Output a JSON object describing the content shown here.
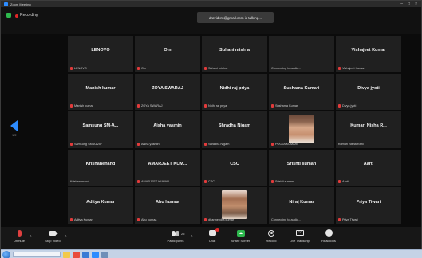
{
  "window": {
    "title": "Zoom Meeting"
  },
  "topbar": {
    "recording_label": "Recording",
    "talking_text": "dravidkru@gmail.com is talking..."
  },
  "participants": [
    {
      "name": "LENOVO",
      "label": "LENOVO",
      "muted": true
    },
    {
      "name": "Om",
      "label": "Om",
      "muted": true
    },
    {
      "name": "Suhani mishra",
      "label": "Suhani mishra",
      "muted": true
    },
    {
      "name": "",
      "label": "Connecting to audio...",
      "muted": false
    },
    {
      "name": "Vishajeet Kumar",
      "label": "Vishajeet Kumar",
      "muted": true
    },
    {
      "name": "Manish kumar",
      "label": "Manish kumar",
      "muted": true
    },
    {
      "name": "ZOYA SWARAJ",
      "label": "ZOYA SWARAJ",
      "muted": true
    },
    {
      "name": "Nidhi raj priya",
      "label": "Nidhi raj priya",
      "muted": true
    },
    {
      "name": "Sushama Kumari",
      "label": "Sushama Kumari",
      "muted": true
    },
    {
      "name": "Divya jyoti",
      "label": "Divya jyoti",
      "muted": true
    },
    {
      "name": "Samsung SM-A...",
      "label": "Samsung SM-A125F",
      "muted": true
    },
    {
      "name": "Aisha yasmin",
      "label": "Aisha yasmin",
      "muted": true
    },
    {
      "name": "Shradha Nigam",
      "label": "Shradha Nigam",
      "muted": true
    },
    {
      "name": "",
      "label": "POOJA KUMARI",
      "muted": true,
      "photo": "female"
    },
    {
      "name": "Kumari Nisha R...",
      "label": "Kumari Nisha Rani",
      "muted": false
    },
    {
      "name": "Krishanenand",
      "label": "Krishanenand",
      "muted": false
    },
    {
      "name": "AMARJEET KUM...",
      "label": "AMARJEET KUMAR",
      "muted": true
    },
    {
      "name": "CSC",
      "label": "CSC",
      "muted": true
    },
    {
      "name": "Srishti suman",
      "label": "Srishti suman",
      "muted": true
    },
    {
      "name": "Aarti",
      "label": "Aarti",
      "muted": true
    },
    {
      "name": "Aditya Kumar",
      "label": "Aditya Kumar",
      "muted": true
    },
    {
      "name": "Abu humaa",
      "label": "Abu humaa",
      "muted": true
    },
    {
      "name": "",
      "label": "dharmendra kumar",
      "muted": true,
      "photo": "male"
    },
    {
      "name": "Niraj Kumar",
      "label": "Connecting to audio...",
      "muted": false
    },
    {
      "name": "Priya Tiwari",
      "label": "Priya Tiwari",
      "muted": true
    }
  ],
  "sidebar": {
    "page_indicator": "1/2"
  },
  "toolbar": {
    "unmute_label": "Unmute",
    "start_video_label": "Stop Video",
    "participants_label": "Participants",
    "participants_count": "25",
    "chat_label": "Chat",
    "share_label": "Share Screen",
    "record_label": "Record",
    "transcript_label": "Live Transcript",
    "reactions_label": "Reactions"
  }
}
